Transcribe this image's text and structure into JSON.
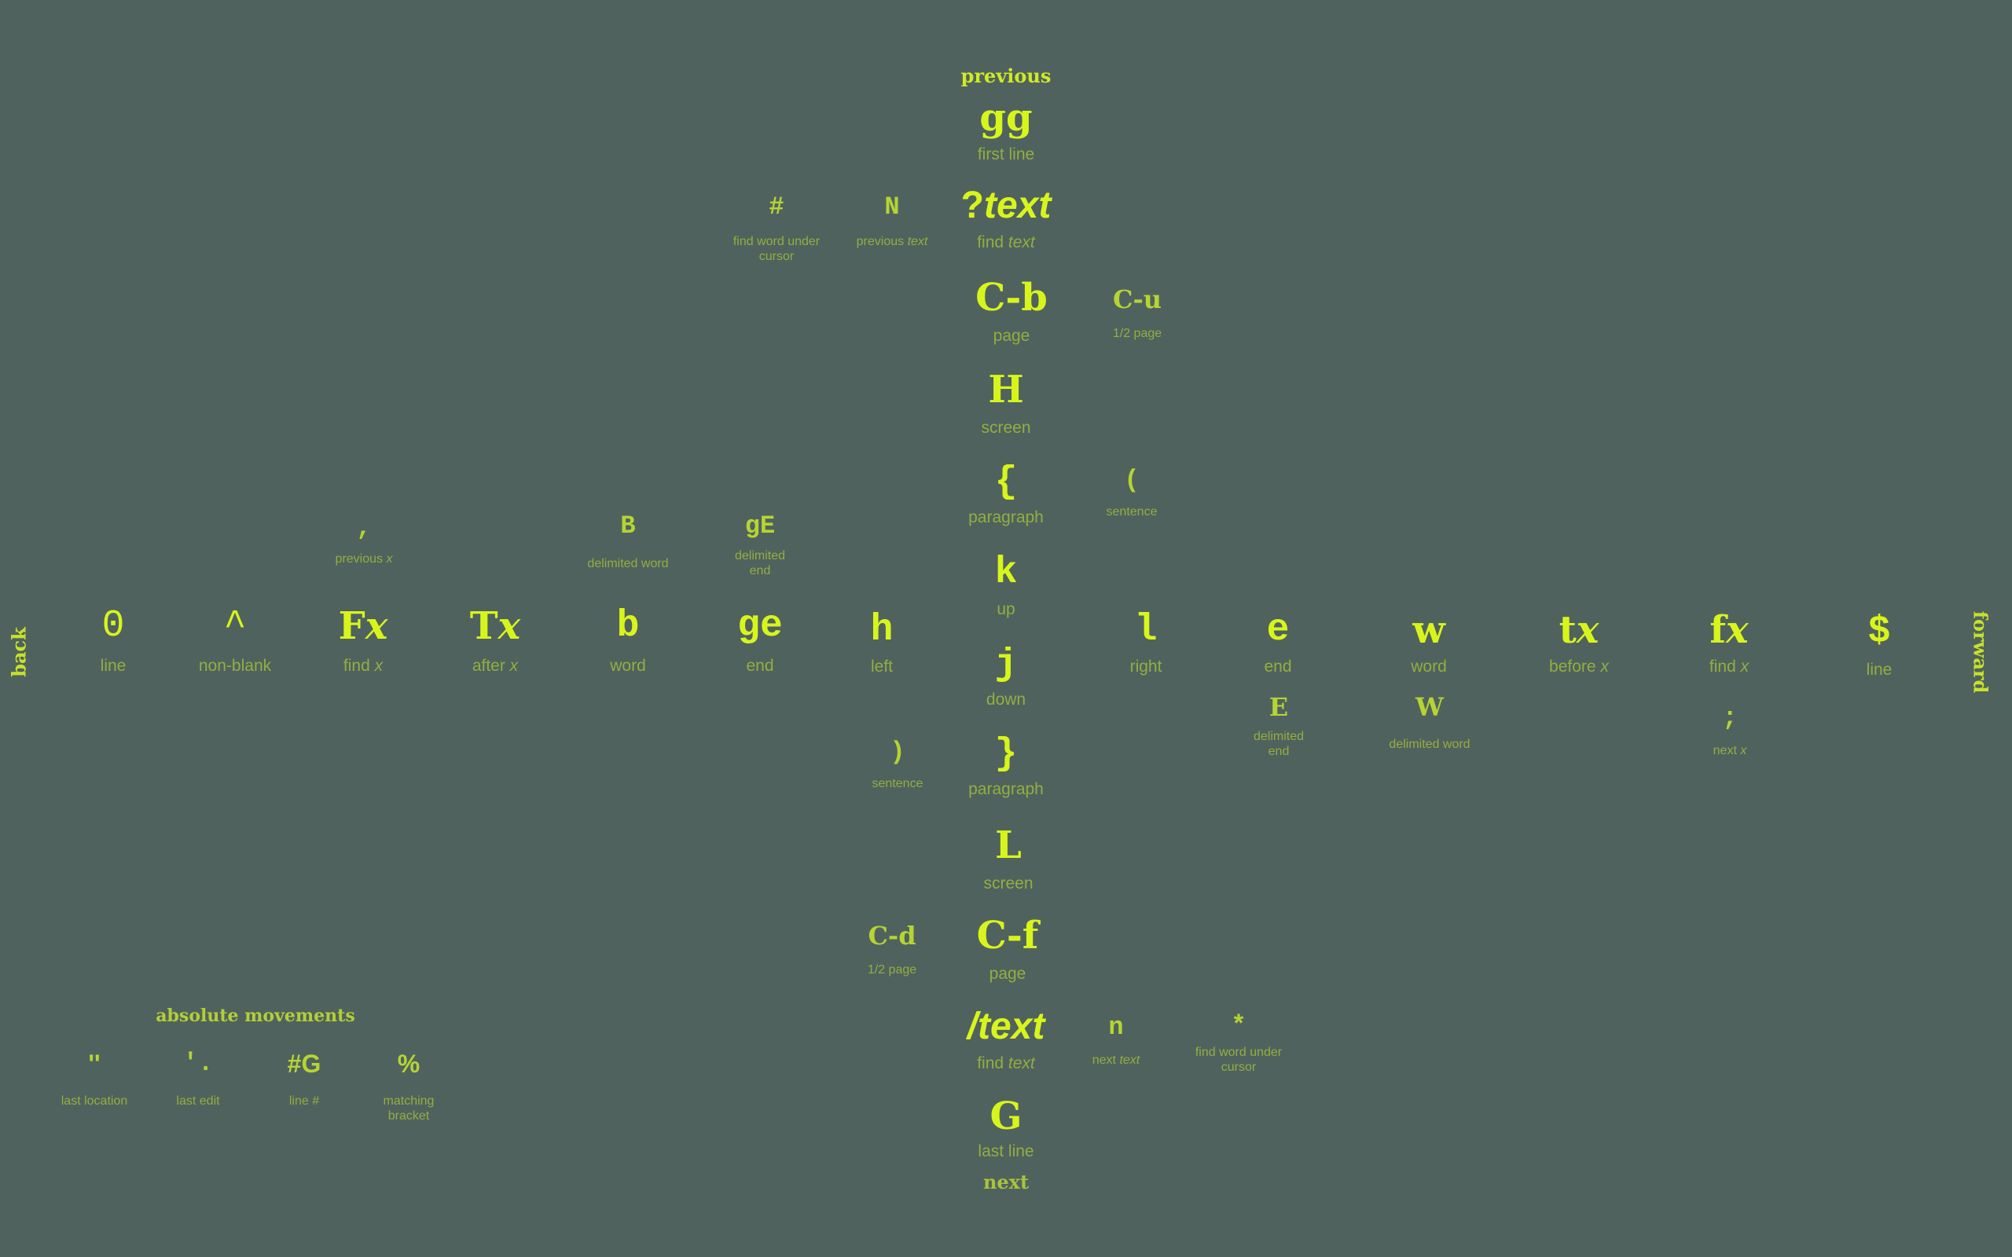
{
  "directions": {
    "previous": "previous",
    "next": "next",
    "back": "back",
    "forward": "forward"
  },
  "colors": {
    "background": "#50625e",
    "primary_key": "#d8f51b",
    "secondary_key": "#b6d433",
    "label": "#93ae3f"
  },
  "vertical": {
    "gg": {
      "key": "gg",
      "label": "first line"
    },
    "qtext": {
      "key_prefix": "?",
      "key_italic": "text",
      "label_prefix": "find ",
      "label_italic": "text"
    },
    "hash": {
      "key": "#",
      "label": "find word under cursor"
    },
    "N": {
      "key": "N",
      "label_prefix": "previous ",
      "label_italic": "text"
    },
    "Cb": {
      "key": "C-b",
      "label": "page"
    },
    "Cu": {
      "key": "C-u",
      "label": "1/2 page"
    },
    "H": {
      "key": "H",
      "label": "screen"
    },
    "lbrace": {
      "key": "{",
      "label": "paragraph"
    },
    "lparen": {
      "key": "(",
      "label": "sentence"
    },
    "k": {
      "key": "k",
      "label": "up"
    },
    "j": {
      "key": "j",
      "label": "down"
    },
    "rbrace": {
      "key": "}",
      "label": "paragraph"
    },
    "rparen": {
      "key": ")",
      "label": "sentence"
    },
    "L": {
      "key": "L",
      "label": "screen"
    },
    "Cf": {
      "key": "C-f",
      "label": "page"
    },
    "Cd": {
      "key": "C-d",
      "label": "1/2 page"
    },
    "stext": {
      "key_prefix": "/",
      "key_italic": "text",
      "label_prefix": "find ",
      "label_italic": "text"
    },
    "n": {
      "key": "n",
      "label_prefix": "next ",
      "label_italic": "text"
    },
    "star": {
      "key": "*",
      "label": "find word under cursor"
    },
    "G": {
      "key": "G",
      "label": "last line"
    }
  },
  "horizontal": {
    "zero": {
      "key": "0",
      "label": "line"
    },
    "caret": {
      "key": "^",
      "label": "non-blank"
    },
    "Fx": {
      "key_prefix": "F",
      "key_italic": "x",
      "label_prefix": "find ",
      "label_italic": "x"
    },
    "comma": {
      "key": ",",
      "label_prefix": "previous ",
      "label_italic": "x"
    },
    "Tx": {
      "key_prefix": "T",
      "key_italic": "x",
      "label_prefix": "after ",
      "label_italic": "x"
    },
    "b": {
      "key": "b",
      "label": "word"
    },
    "B": {
      "key": "B",
      "label": "delimited word"
    },
    "ge": {
      "key": "ge",
      "label": "end"
    },
    "gE": {
      "key": "gE",
      "label": "delimited end"
    },
    "h": {
      "key": "h",
      "label": "left"
    },
    "l": {
      "key": "l",
      "label": "right"
    },
    "e": {
      "key": "e",
      "label": "end"
    },
    "E": {
      "key": "E",
      "label": "delimited end"
    },
    "w": {
      "key": "w",
      "label": "word"
    },
    "W": {
      "key": "W",
      "label": "delimited word"
    },
    "tx": {
      "key_prefix": "t",
      "key_italic": "x",
      "label_prefix": "before ",
      "label_italic": "x"
    },
    "fx": {
      "key_prefix": "f",
      "key_italic": "x",
      "label_prefix": "find ",
      "label_italic": "x"
    },
    "semi": {
      "key": ";",
      "label_prefix": "next ",
      "label_italic": "x"
    },
    "dollar": {
      "key": "$",
      "label": "line"
    }
  },
  "absolute": {
    "title": "absolute movements",
    "items": [
      {
        "key": "''",
        "label": "last location"
      },
      {
        "key": "'.",
        "label": "last edit"
      },
      {
        "key": "#G",
        "label": "line #"
      },
      {
        "key": "%",
        "label": "matching bracket"
      }
    ]
  }
}
